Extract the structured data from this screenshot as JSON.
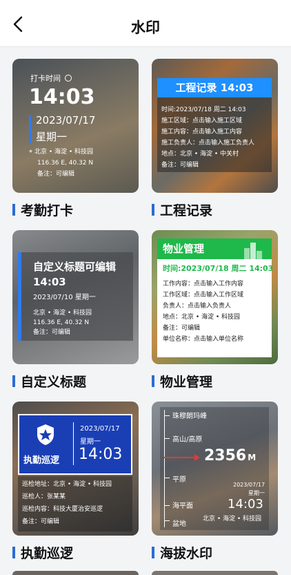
{
  "header": {
    "title": "水印"
  },
  "cards": {
    "attendance": {
      "label": "考勤打卡",
      "punch_label": "打卡时间",
      "time": "14:03",
      "date": "2023/07/17",
      "weekday": "星期一",
      "location": "北京 • 海淀 • 科技园",
      "coords": "116.36 E, 40.32 N",
      "note": "备注：可编辑"
    },
    "engineering": {
      "label": "工程记录",
      "banner": "工程记录 14:03",
      "lines": [
        "时间:2023/07/18 周二 14:03",
        "施工区域：点击输入施工区域",
        "施工内容：点击输入施工内容",
        "施工负责人：点击输入施工负责人",
        "地点：北京 • 海淀 • 中关村",
        "备注：可编辑"
      ],
      "accent": "#1e90ff"
    },
    "custom": {
      "label": "自定义标题",
      "heading": "自定义标题可编辑",
      "time": "14:03",
      "date_line": "2023/07/10 星期一",
      "location": "北京 • 海淀 • 科技园",
      "coords": "116.36 E, 40.32 N",
      "note": "备注：可编辑"
    },
    "property": {
      "label": "物业管理",
      "banner": "物业管理",
      "time_line": "时间:2023/07/18 周二 14:03",
      "lines": [
        "工作内容：点击输入工作内容",
        "工作区域：点击输入工作区域",
        "负责人：点击输入负责人",
        "地点：北京 • 海淀 • 科技园",
        "备注：可编辑",
        "单位名称：点击输入单位名称"
      ],
      "accent": "#1fb84a"
    },
    "patrol": {
      "label": "执勤巡逻",
      "badge": "执勤巡逻",
      "date": "2023/07/17",
      "weekday": "星期一",
      "time": "14:03",
      "lines": [
        "巡检地址：北京 • 海淀 • 科技园",
        "巡检人：张某某",
        "巡检内容：科技大厦治安巡逻",
        "备注：可编辑"
      ],
      "accent": "#1a3fb5"
    },
    "altitude": {
      "label": "海拔水印",
      "scale_labels": [
        "珠穆朗玛峰",
        "高山/高原",
        "平原",
        "海平面",
        "盆地"
      ],
      "value": "2356",
      "unit": "M",
      "date": "2023/07/17",
      "weekday": "星期一",
      "time": "14:03",
      "location": "北京 • 海淀 • 科技园",
      "marker_color": "#e53935"
    }
  }
}
